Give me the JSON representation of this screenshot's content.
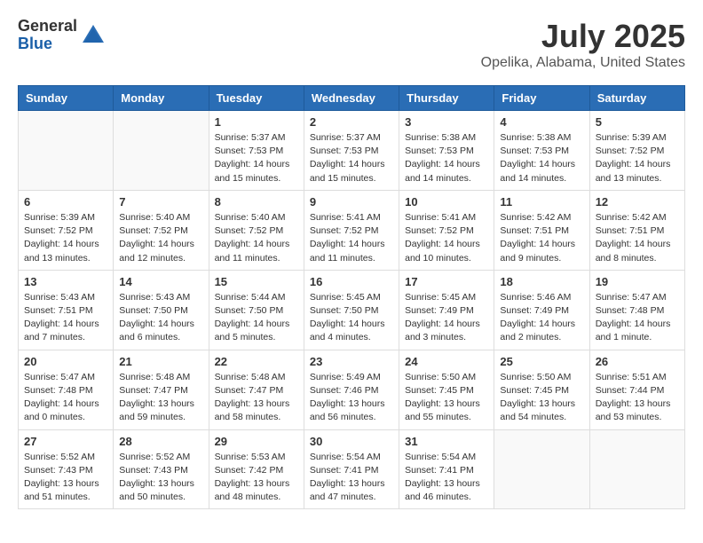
{
  "header": {
    "logo_general": "General",
    "logo_blue": "Blue",
    "month": "July 2025",
    "location": "Opelika, Alabama, United States"
  },
  "days_of_week": [
    "Sunday",
    "Monday",
    "Tuesday",
    "Wednesday",
    "Thursday",
    "Friday",
    "Saturday"
  ],
  "weeks": [
    [
      {
        "day": "",
        "info": ""
      },
      {
        "day": "",
        "info": ""
      },
      {
        "day": "1",
        "info": "Sunrise: 5:37 AM\nSunset: 7:53 PM\nDaylight: 14 hours\nand 15 minutes."
      },
      {
        "day": "2",
        "info": "Sunrise: 5:37 AM\nSunset: 7:53 PM\nDaylight: 14 hours\nand 15 minutes."
      },
      {
        "day": "3",
        "info": "Sunrise: 5:38 AM\nSunset: 7:53 PM\nDaylight: 14 hours\nand 14 minutes."
      },
      {
        "day": "4",
        "info": "Sunrise: 5:38 AM\nSunset: 7:53 PM\nDaylight: 14 hours\nand 14 minutes."
      },
      {
        "day": "5",
        "info": "Sunrise: 5:39 AM\nSunset: 7:52 PM\nDaylight: 14 hours\nand 13 minutes."
      }
    ],
    [
      {
        "day": "6",
        "info": "Sunrise: 5:39 AM\nSunset: 7:52 PM\nDaylight: 14 hours\nand 13 minutes."
      },
      {
        "day": "7",
        "info": "Sunrise: 5:40 AM\nSunset: 7:52 PM\nDaylight: 14 hours\nand 12 minutes."
      },
      {
        "day": "8",
        "info": "Sunrise: 5:40 AM\nSunset: 7:52 PM\nDaylight: 14 hours\nand 11 minutes."
      },
      {
        "day": "9",
        "info": "Sunrise: 5:41 AM\nSunset: 7:52 PM\nDaylight: 14 hours\nand 11 minutes."
      },
      {
        "day": "10",
        "info": "Sunrise: 5:41 AM\nSunset: 7:52 PM\nDaylight: 14 hours\nand 10 minutes."
      },
      {
        "day": "11",
        "info": "Sunrise: 5:42 AM\nSunset: 7:51 PM\nDaylight: 14 hours\nand 9 minutes."
      },
      {
        "day": "12",
        "info": "Sunrise: 5:42 AM\nSunset: 7:51 PM\nDaylight: 14 hours\nand 8 minutes."
      }
    ],
    [
      {
        "day": "13",
        "info": "Sunrise: 5:43 AM\nSunset: 7:51 PM\nDaylight: 14 hours\nand 7 minutes."
      },
      {
        "day": "14",
        "info": "Sunrise: 5:43 AM\nSunset: 7:50 PM\nDaylight: 14 hours\nand 6 minutes."
      },
      {
        "day": "15",
        "info": "Sunrise: 5:44 AM\nSunset: 7:50 PM\nDaylight: 14 hours\nand 5 minutes."
      },
      {
        "day": "16",
        "info": "Sunrise: 5:45 AM\nSunset: 7:50 PM\nDaylight: 14 hours\nand 4 minutes."
      },
      {
        "day": "17",
        "info": "Sunrise: 5:45 AM\nSunset: 7:49 PM\nDaylight: 14 hours\nand 3 minutes."
      },
      {
        "day": "18",
        "info": "Sunrise: 5:46 AM\nSunset: 7:49 PM\nDaylight: 14 hours\nand 2 minutes."
      },
      {
        "day": "19",
        "info": "Sunrise: 5:47 AM\nSunset: 7:48 PM\nDaylight: 14 hours\nand 1 minute."
      }
    ],
    [
      {
        "day": "20",
        "info": "Sunrise: 5:47 AM\nSunset: 7:48 PM\nDaylight: 14 hours\nand 0 minutes."
      },
      {
        "day": "21",
        "info": "Sunrise: 5:48 AM\nSunset: 7:47 PM\nDaylight: 13 hours\nand 59 minutes."
      },
      {
        "day": "22",
        "info": "Sunrise: 5:48 AM\nSunset: 7:47 PM\nDaylight: 13 hours\nand 58 minutes."
      },
      {
        "day": "23",
        "info": "Sunrise: 5:49 AM\nSunset: 7:46 PM\nDaylight: 13 hours\nand 56 minutes."
      },
      {
        "day": "24",
        "info": "Sunrise: 5:50 AM\nSunset: 7:45 PM\nDaylight: 13 hours\nand 55 minutes."
      },
      {
        "day": "25",
        "info": "Sunrise: 5:50 AM\nSunset: 7:45 PM\nDaylight: 13 hours\nand 54 minutes."
      },
      {
        "day": "26",
        "info": "Sunrise: 5:51 AM\nSunset: 7:44 PM\nDaylight: 13 hours\nand 53 minutes."
      }
    ],
    [
      {
        "day": "27",
        "info": "Sunrise: 5:52 AM\nSunset: 7:43 PM\nDaylight: 13 hours\nand 51 minutes."
      },
      {
        "day": "28",
        "info": "Sunrise: 5:52 AM\nSunset: 7:43 PM\nDaylight: 13 hours\nand 50 minutes."
      },
      {
        "day": "29",
        "info": "Sunrise: 5:53 AM\nSunset: 7:42 PM\nDaylight: 13 hours\nand 48 minutes."
      },
      {
        "day": "30",
        "info": "Sunrise: 5:54 AM\nSunset: 7:41 PM\nDaylight: 13 hours\nand 47 minutes."
      },
      {
        "day": "31",
        "info": "Sunrise: 5:54 AM\nSunset: 7:41 PM\nDaylight: 13 hours\nand 46 minutes."
      },
      {
        "day": "",
        "info": ""
      },
      {
        "day": "",
        "info": ""
      }
    ]
  ]
}
